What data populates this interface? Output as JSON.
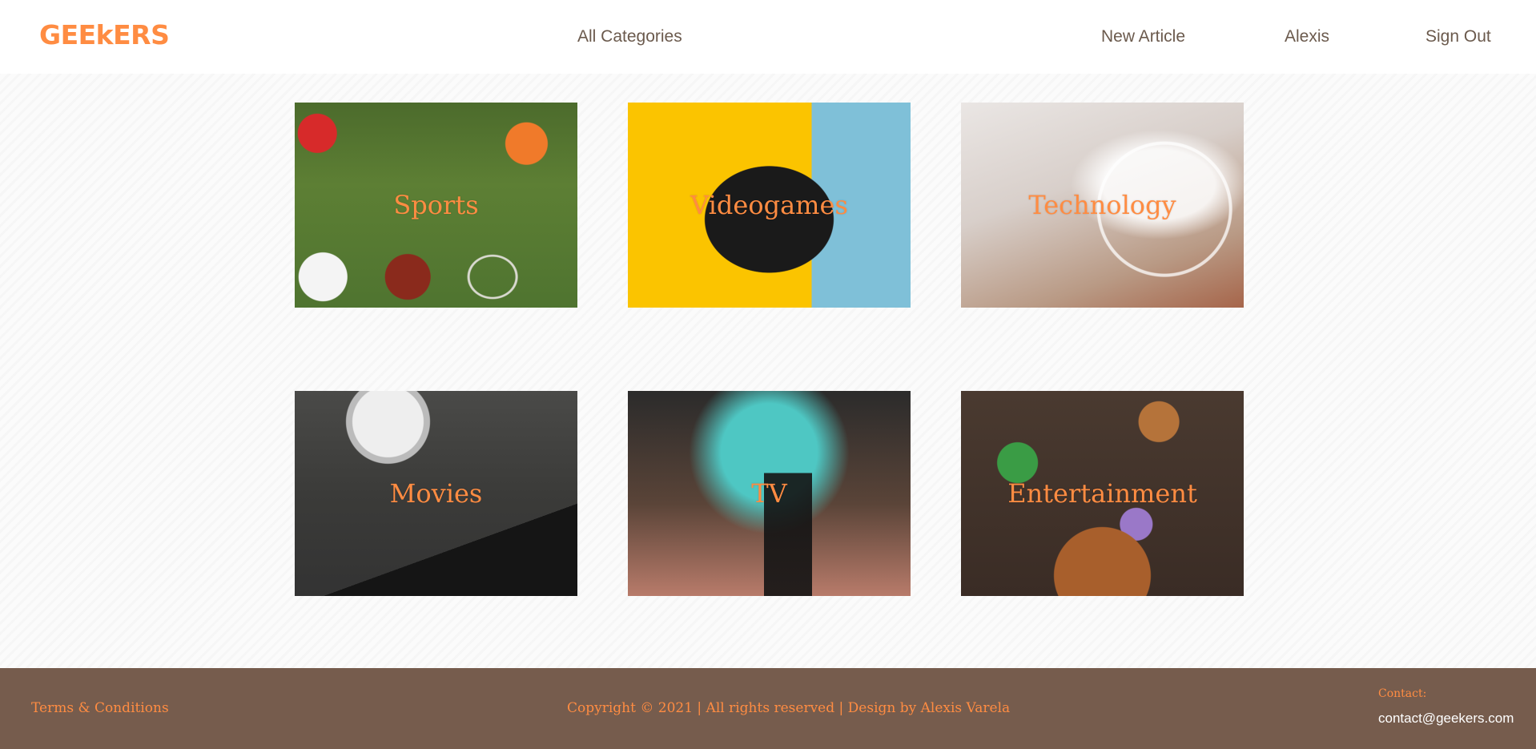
{
  "navbar": {
    "logo": "GEEkERS",
    "all_categories": "All Categories",
    "new_article": "New Article",
    "user": "Alexis",
    "sign_out": "Sign Out"
  },
  "categories": [
    {
      "label": "Sports"
    },
    {
      "label": "Videogames"
    },
    {
      "label": "Technology"
    },
    {
      "label": "Movies"
    },
    {
      "label": "TV"
    },
    {
      "label": "Entertainment"
    }
  ],
  "footer": {
    "terms": "Terms & Conditions",
    "copyright": "Copyright © 2021 | All rights reserved | Design by Alexis Varela",
    "contact_label": "Contact:",
    "contact_email": "contact@geekers.com"
  },
  "colors": {
    "accent": "#ff8c42",
    "nav_text": "#6b5a4d",
    "footer_bg": "#765c4d",
    "page_bg": "#fbfbfb"
  }
}
